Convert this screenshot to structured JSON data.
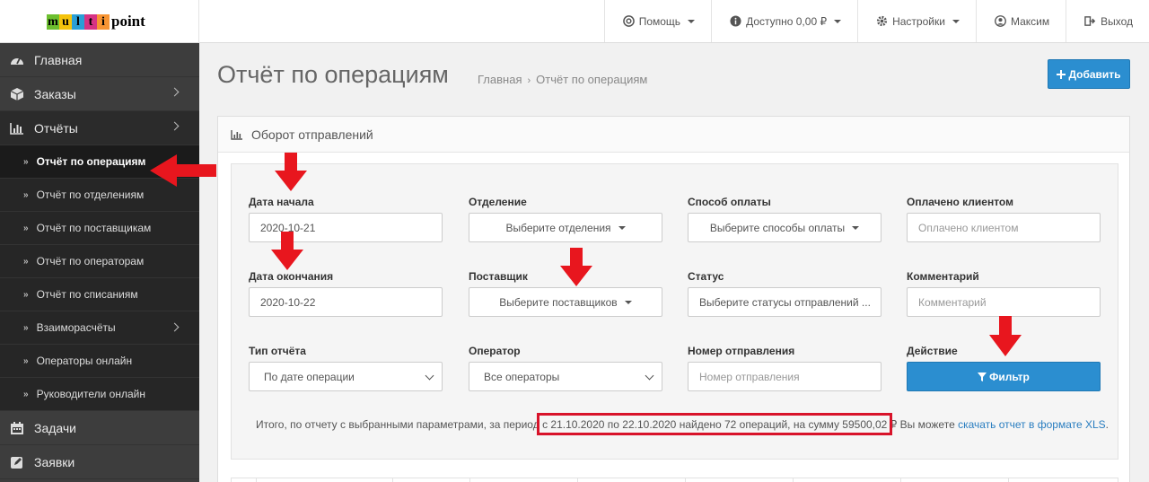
{
  "logo": {
    "letters": [
      "m",
      "u",
      "l",
      "t",
      "i"
    ],
    "rest": "point"
  },
  "topnav": {
    "help": "Помощь",
    "balance": "Доступно 0,00 ₽",
    "settings": "Настройки",
    "user": "Максим",
    "logout": "Выход"
  },
  "sidebar": {
    "home": "Главная",
    "orders": "Заказы",
    "reports": "Отчёты",
    "sub": [
      "Отчёт по операциям",
      "Отчёт по отделениям",
      "Отчёт по поставщикам",
      "Отчёт по операторам",
      "Отчёт по списаниям",
      "Взаиморасчёты",
      "Операторы онлайн",
      "Руководители онлайн"
    ],
    "tasks": "Задачи",
    "requests": "Заявки"
  },
  "page": {
    "title": "Отчёт по операциям",
    "breadcrumb_home": "Главная",
    "breadcrumb_current": "Отчёт по операциям",
    "add_button": "Добавить"
  },
  "panel": {
    "title": "Оборот отправлений"
  },
  "filters": {
    "start_date_label": "Дата начала",
    "start_date_value": "2020-10-21",
    "department_label": "Отделение",
    "department_value": "Выберите отделения",
    "payment_label": "Способ оплаты",
    "payment_value": "Выберите способы оплаты",
    "paid_label": "Оплачено клиентом",
    "paid_placeholder": "Оплачено клиентом",
    "end_date_label": "Дата окончания",
    "end_date_value": "2020-10-22",
    "supplier_label": "Поставщик",
    "supplier_value": "Выберите поставщиков",
    "status_label": "Статус",
    "status_value": "Выберите статусы отправлений ...",
    "comment_label": "Комментарий",
    "comment_placeholder": "Комментарий",
    "report_type_label": "Тип отчёта",
    "report_type_value": "По дате операции",
    "operator_label": "Оператор",
    "operator_value": "Все операторы",
    "tracking_label": "Номер отправления",
    "tracking_placeholder": "Номер отправления",
    "action_label": "Действие",
    "filter_button": "Фильтр"
  },
  "summary": {
    "prefix": "Итого, по отчету с выбранными параметрами, за период ",
    "highlight": "с 21.10.2020 по 22.10.2020 найдено 72 операций, на сумму 59500,02 ₽",
    "suffix": " Вы можете ",
    "link": "скачать отчет в формате XLS",
    "end": "."
  },
  "colors": {
    "primary": "#2b8ed0",
    "sidebar": "#3d3d3d",
    "annotation": "#e8161e"
  }
}
